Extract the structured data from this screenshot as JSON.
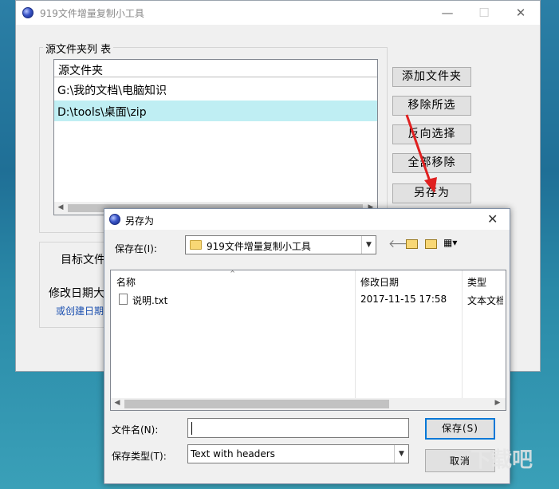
{
  "main": {
    "title": "919文件增量复制小工具",
    "window_controls": {
      "minimize": "—",
      "maximize": "☐",
      "close": "✕"
    },
    "source_group": {
      "legend": "源文件夹列 表",
      "column_header": "源文件夹",
      "rows": [
        "G:\\我的文档\\电脑知识",
        "D:\\tools\\桌面\\zip"
      ],
      "selected_index": 1
    },
    "buttons": {
      "add": "添加文件夹",
      "remove_selected": "移除所选",
      "invert": "反向选择",
      "remove_all": "全部移除",
      "save_as": "另存为"
    },
    "target_group": {
      "label": "目标文件",
      "date_label": "修改日期大",
      "or_create": "或创建日期"
    }
  },
  "dialog": {
    "title": "另存为",
    "save_in_label": "保存在(I):",
    "save_in_value": "919文件增量复制小工具",
    "columns": {
      "name": "名称",
      "date": "修改日期",
      "type": "类型"
    },
    "files": [
      {
        "name": "说明.txt",
        "date": "2017-11-15 17:58",
        "type": "文本文档"
      }
    ],
    "filename_label": "文件名(N):",
    "filename_value": "",
    "filetype_label": "保存类型(T):",
    "filetype_value": "Text with headers",
    "save_button": "保存(S)",
    "cancel_button": "取消",
    "close": "✕"
  },
  "watermark": "下载吧",
  "colors": {
    "selection": "#bfeef3",
    "annotation_arrow": "#e02020",
    "focus_border": "#0078d7"
  }
}
